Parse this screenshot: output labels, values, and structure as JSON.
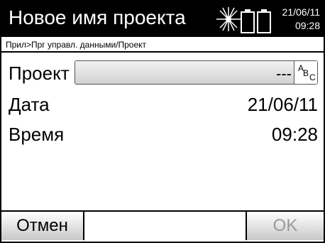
{
  "header": {
    "title": "Новое имя проекта",
    "date": "21/06/11",
    "time": "09:28",
    "status_icons": [
      "laser-icon",
      "battery-icon",
      "battery-icon"
    ]
  },
  "breadcrumb": "Прил>Прг управл. данными/Проект",
  "fields": {
    "project": {
      "label": "Проект",
      "value": "---",
      "input_mode": {
        "a": "A",
        "b": "B",
        "c": "C"
      }
    },
    "date": {
      "label": "Дата",
      "value": "21/06/11"
    },
    "time": {
      "label": "Время",
      "value": "09:28"
    }
  },
  "softkeys": {
    "cancel": "Отмен",
    "middle": "",
    "ok": "OK"
  },
  "colors": {
    "bar": "#000000",
    "disabled_text": "#9a9a9a"
  }
}
